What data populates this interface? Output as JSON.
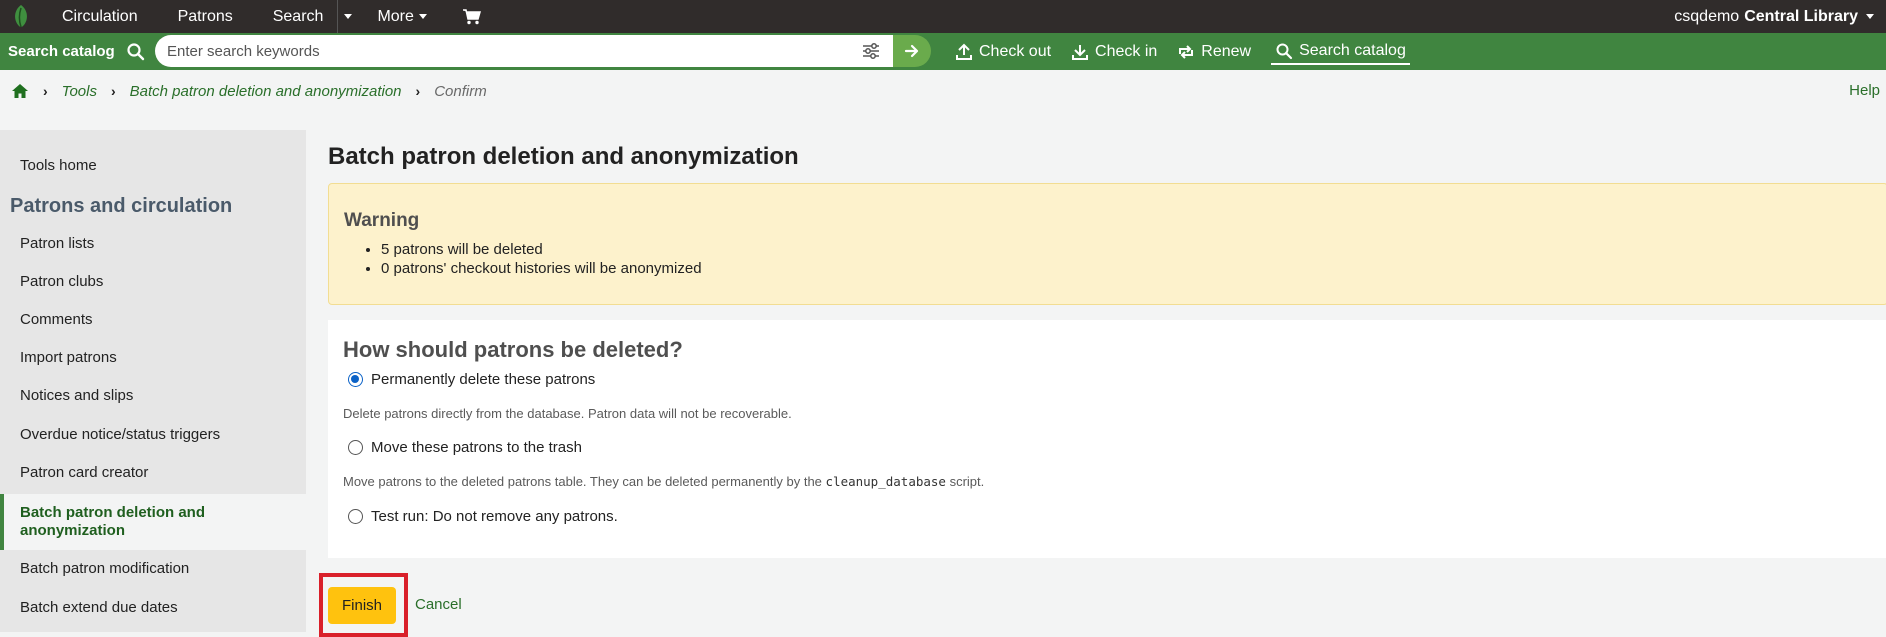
{
  "topnav": {
    "items": [
      "Circulation",
      "Patrons",
      "Search",
      "More"
    ],
    "user": "csqdemo",
    "library": "Central Library"
  },
  "searchbar": {
    "label": "Search catalog",
    "placeholder": "Enter search keywords",
    "actions": [
      "Check out",
      "Check in",
      "Renew",
      "Search catalog"
    ]
  },
  "breadcrumb": {
    "items": [
      "Tools",
      "Batch patron deletion and anonymization",
      "Confirm"
    ],
    "help": "Help"
  },
  "sidebar": {
    "tools_home": "Tools home",
    "section_title": "Patrons and circulation",
    "items": [
      "Patron lists",
      "Patron clubs",
      "Comments",
      "Import patrons",
      "Notices and slips",
      "Overdue notice/status triggers",
      "Patron card creator",
      "Batch patron deletion and anonymization",
      "Batch patron modification",
      "Batch extend due dates"
    ]
  },
  "main": {
    "title": "Batch patron deletion and anonymization",
    "warning": {
      "title": "Warning",
      "items": [
        "5 patrons will be deleted",
        "0 patrons' checkout histories will be anonymized"
      ]
    },
    "question": "How should patrons be deleted?",
    "options": [
      {
        "label": "Permanently delete these patrons",
        "checked": true
      },
      {
        "label": "Move these patrons to the trash",
        "checked": false
      },
      {
        "label": "Test run: Do not remove any patrons.",
        "checked": false
      }
    ],
    "hint_permanent": "Delete patrons directly from the database. Patron data will not be recoverable.",
    "hint_trash_before": "Move patrons to the deleted patrons table. They can be deleted permanently by the ",
    "hint_trash_code": "cleanup_database",
    "hint_trash_after": " script.",
    "finish": "Finish",
    "cancel": "Cancel"
  },
  "colors": {
    "topnav_bg": "#302c2b",
    "brand_green": "#408540",
    "link_green": "#2a6f2a",
    "warning_bg": "#fdf2cc",
    "finish_bg": "#ffc20e",
    "highlight_red": "#d9202a"
  }
}
